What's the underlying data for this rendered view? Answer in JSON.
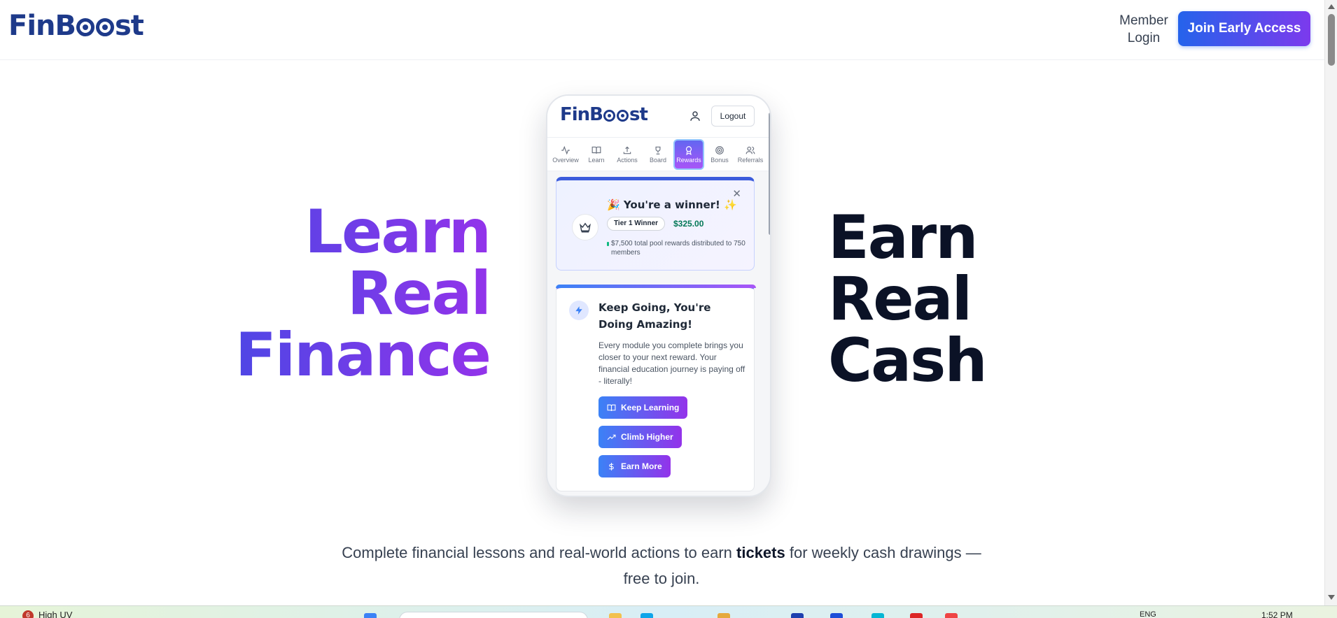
{
  "brand": {
    "name_prefix": "FinB",
    "name_suffix": "st",
    "primary_color": "#1e3a8a",
    "gradient_from": "#2563eb",
    "gradient_to": "#7c3aed"
  },
  "header": {
    "member_login_line1": "Member",
    "member_login_line2": "Login",
    "cta_label": "Join Early Access"
  },
  "hero": {
    "left_lines": [
      "Learn",
      "Real",
      "Finance"
    ],
    "right_lines": [
      "Earn",
      "Real",
      "Cash"
    ]
  },
  "phone": {
    "logout_label": "Logout",
    "nav": [
      {
        "label": "Overview",
        "icon": "activity-icon"
      },
      {
        "label": "Learn",
        "icon": "book-icon"
      },
      {
        "label": "Actions",
        "icon": "upload-icon"
      },
      {
        "label": "Board",
        "icon": "trophy-icon"
      },
      {
        "label": "Rewards",
        "icon": "award-icon",
        "active": true
      },
      {
        "label": "Bonus",
        "icon": "target-icon"
      },
      {
        "label": "Referrals",
        "icon": "users-icon"
      }
    ],
    "winner": {
      "title": "🎉 You're a winner! ✨",
      "tier": "Tier 1 Winner",
      "amount": "$325.00",
      "pool_text": "$7,500 total pool rewards distributed to 750 members"
    },
    "motivation": {
      "title": "Keep Going, You're Doing Amazing!",
      "body": "Every module you complete brings you closer to your next reward. Your financial education journey is paying off - literally!",
      "buttons": [
        "Keep Learning",
        "Climb Higher",
        "Earn More"
      ]
    }
  },
  "subtext": {
    "before": "Complete financial lessons and real-world actions to earn ",
    "bold": "tickets",
    "after": " for weekly cash drawings — free to join."
  },
  "taskbar": {
    "badge_count": "6",
    "weather": "High UV",
    "language": "ENG",
    "time": "1:52 PM"
  }
}
